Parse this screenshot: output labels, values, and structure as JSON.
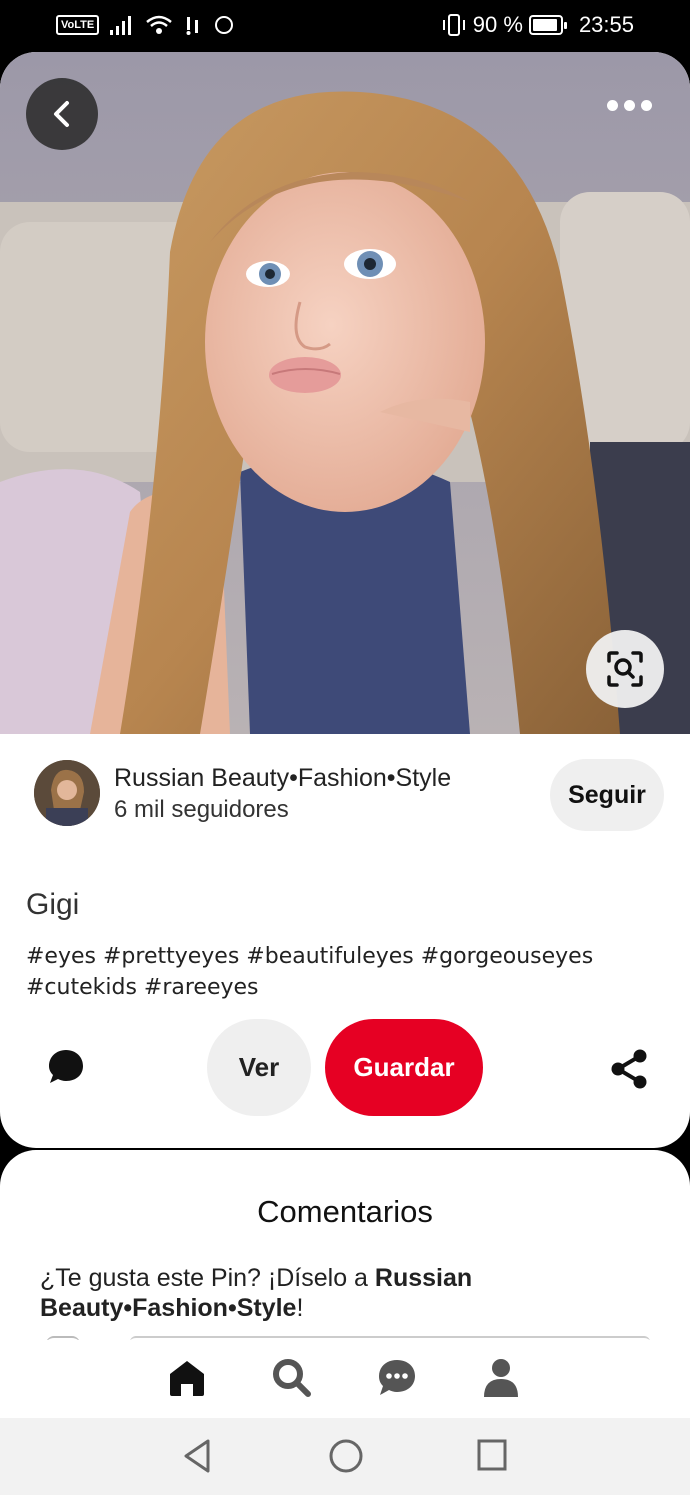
{
  "status_bar": {
    "network_badge": "VoLTE",
    "battery_percent": "90 %",
    "time": "23:55"
  },
  "pin": {
    "creator_name": "Russian Beauty•Fashion•Style",
    "creator_followers": "6 mil seguidores",
    "follow_label": "Seguir",
    "title": "Gigi",
    "description": "#eyes #prettyeyes #beautifuleyes #gorgeouseyes #cutekids #rareeyes",
    "ver_label": "Ver",
    "save_label": "Guardar"
  },
  "comments": {
    "title": "Comentarios",
    "prompt_prefix": "¿Te gusta este Pin? ¡Díselo a ",
    "prompt_name": "Russian Beauty•Fashion•Style",
    "prompt_suffix": "!"
  },
  "tabs": [
    "home-icon",
    "search-icon",
    "messages-icon",
    "profile-icon"
  ],
  "colors": {
    "accent": "#e60023",
    "button_gray": "#efefef"
  }
}
